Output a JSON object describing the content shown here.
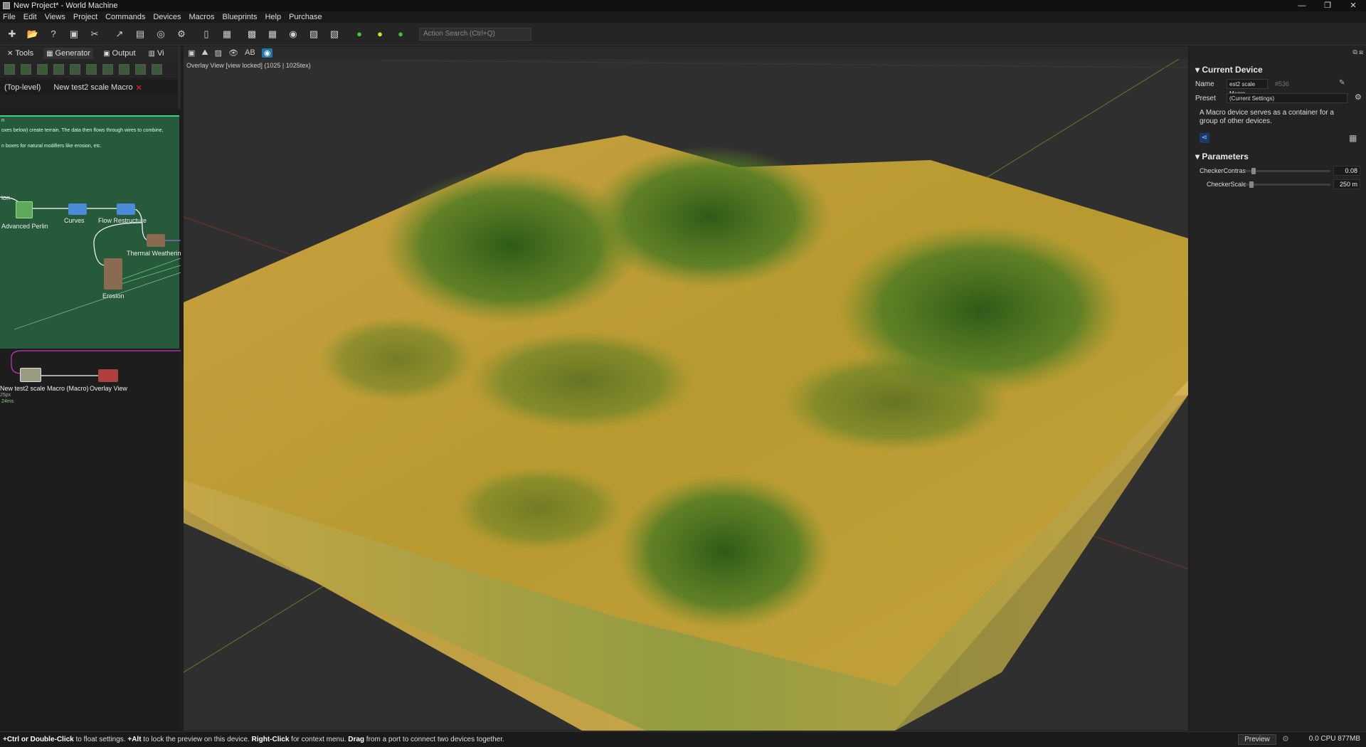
{
  "window": {
    "title": "New Project* - World Machine",
    "controls": [
      "—",
      "❐",
      "✕"
    ]
  },
  "menu": [
    "File",
    "Edit",
    "Views",
    "Project",
    "Commands",
    "Devices",
    "Macros",
    "Blueprints",
    "Help",
    "Purchase"
  ],
  "toolbar": {
    "search_placeholder": "Action Search (Ctrl+Q)"
  },
  "library_tabs": [
    {
      "label": "Tools",
      "icon": "✕"
    },
    {
      "label": "Generator",
      "icon": "▦"
    },
    {
      "label": "Output",
      "icon": "▣"
    },
    {
      "label": "Vi",
      "icon": "▥"
    }
  ],
  "graph_tabs": {
    "top": "(Top-level)",
    "macro": "New test2 scale Macro",
    "close": "✕"
  },
  "graph": {
    "notes": [
      "n",
      "oxes below) create terrain. The data then flows through wires to combine,",
      "n boxes for natural modifiers like erosion, etc."
    ],
    "nodes": {
      "ion": "ion",
      "advanced_perlin": "Advanced Perlin",
      "curves": "Curves",
      "flow": "Flow Restructure",
      "thermal": "Thermal Weatherin",
      "erosion": "Erosion",
      "macro": "New test2 scale Macro (Macro)",
      "overlay": "Overlay View",
      "macro_meta1": "25px",
      "macro_meta2": "24ms"
    }
  },
  "viewport": {
    "toolbar_ab": "AB",
    "info": "Overlay View [view locked] (1025 | 1025tex)"
  },
  "device": {
    "section": "Current Device",
    "name_label": "Name",
    "name_value": "est2 scale Macro",
    "id": "#536",
    "preset_label": "Preset",
    "preset_value": "(Current Settings)",
    "description": "A Macro device serves as a container for a group of other devices."
  },
  "parameters": {
    "section": "Parameters",
    "items": [
      {
        "name": "CheckerContras",
        "value": "0.08",
        "fraction": 0.08
      },
      {
        "name": "CheckerScale",
        "value": "250 m",
        "fraction": 0.05
      }
    ]
  },
  "status": {
    "p1": "+Ctrl or Double-Click",
    "p2": " to float settings. ",
    "p3": "+Alt",
    "p4": " to lock the preview on this device. ",
    "p5": "Right-Click",
    "p6": " for context menu. ",
    "p7": "Drag",
    "p8": " from a port to connect two devices together.",
    "preview": "Preview",
    "cpu": "0.0 CPU 877MB"
  }
}
